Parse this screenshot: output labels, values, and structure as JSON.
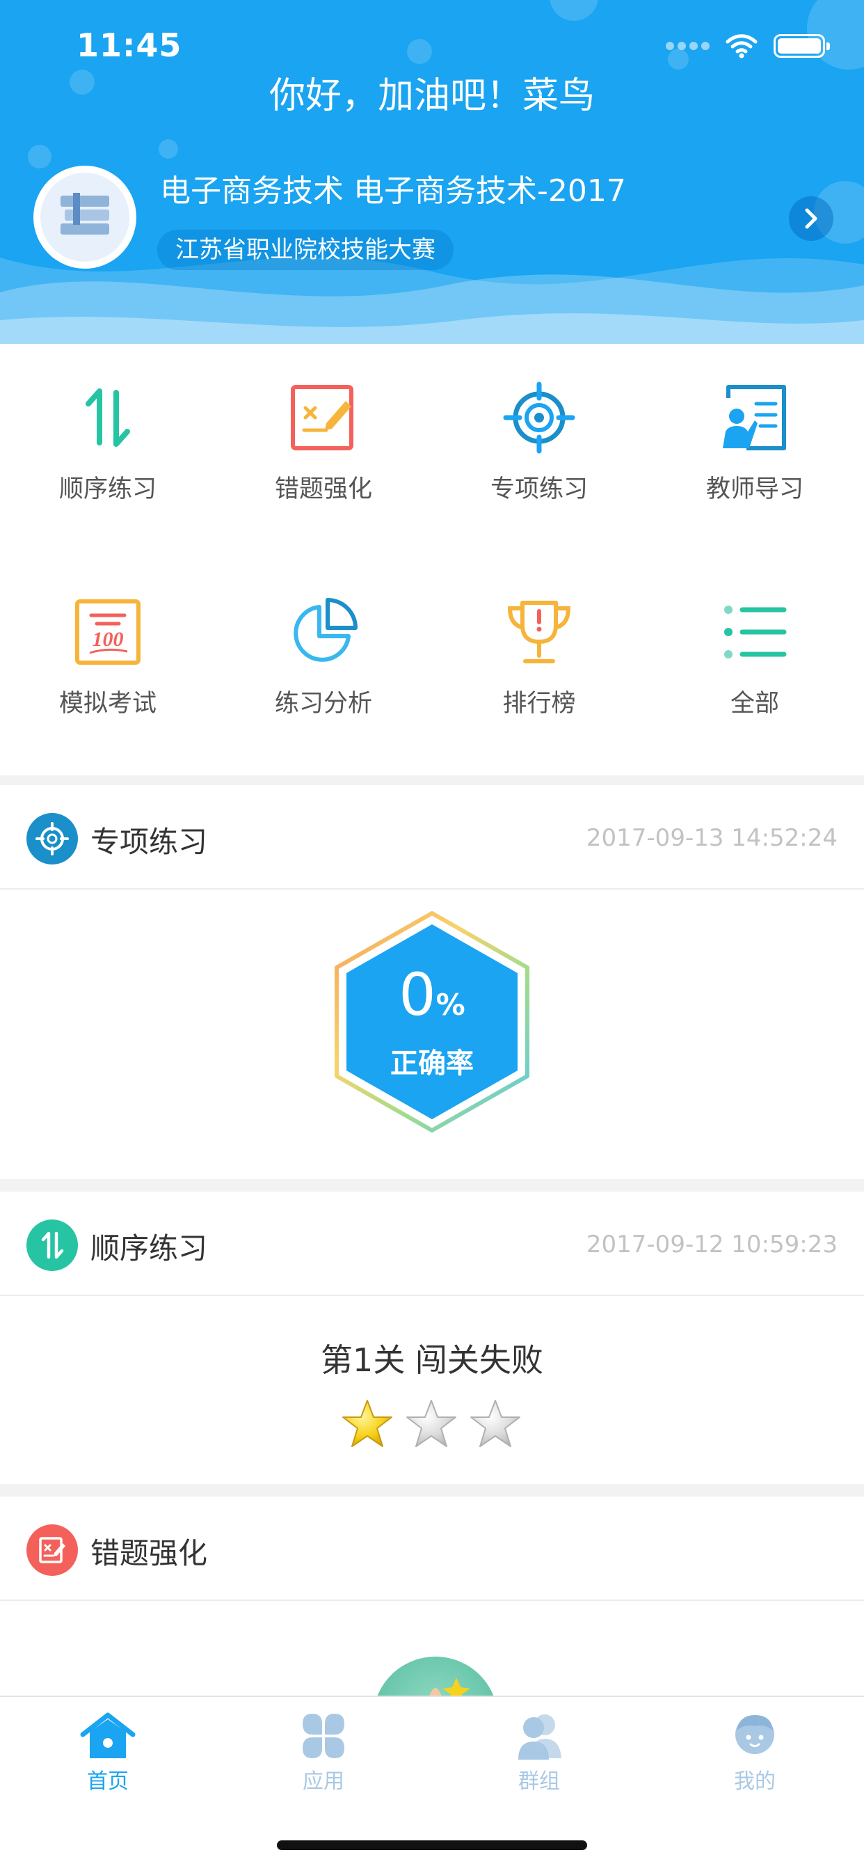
{
  "status": {
    "time": "11:45"
  },
  "header": {
    "greeting": "你好，加油吧！菜鸟",
    "course_title": "电子商务技术  电子商务技术-2017",
    "course_tag": "江苏省职业院校技能大赛"
  },
  "grid": [
    {
      "label": "顺序练习",
      "icon": "sequence-arrows-icon"
    },
    {
      "label": "错题强化",
      "icon": "wrong-question-edit-icon"
    },
    {
      "label": "专项练习",
      "icon": "target-icon"
    },
    {
      "label": "教师导习",
      "icon": "teacher-board-icon"
    },
    {
      "label": "模拟考试",
      "icon": "score-100-icon"
    },
    {
      "label": "练习分析",
      "icon": "pie-chart-icon"
    },
    {
      "label": "排行榜",
      "icon": "trophy-icon"
    },
    {
      "label": "全部",
      "icon": "list-icon"
    }
  ],
  "cards": {
    "special": {
      "title": "专项练习",
      "time": "2017-09-13 14:52:24",
      "percent": "0",
      "percent_sign": "%",
      "rate_label": "正确率"
    },
    "sequence": {
      "title": "顺序练习",
      "time": "2017-09-12 10:59:23",
      "level_text": "第1关 闯关失败",
      "stars_earned": 1,
      "stars_total": 3
    },
    "wrong": {
      "title": "错题强化"
    }
  },
  "tabs": [
    {
      "label": "首页",
      "icon": "home-icon",
      "active": true
    },
    {
      "label": "应用",
      "icon": "apps-icon",
      "active": false
    },
    {
      "label": "群组",
      "icon": "group-icon",
      "active": false
    },
    {
      "label": "我的",
      "icon": "profile-icon",
      "active": false
    }
  ],
  "colors": {
    "primary": "#1aa4f1",
    "teal": "#26c4a3",
    "red": "#f4615b",
    "orange": "#f6b43b"
  }
}
